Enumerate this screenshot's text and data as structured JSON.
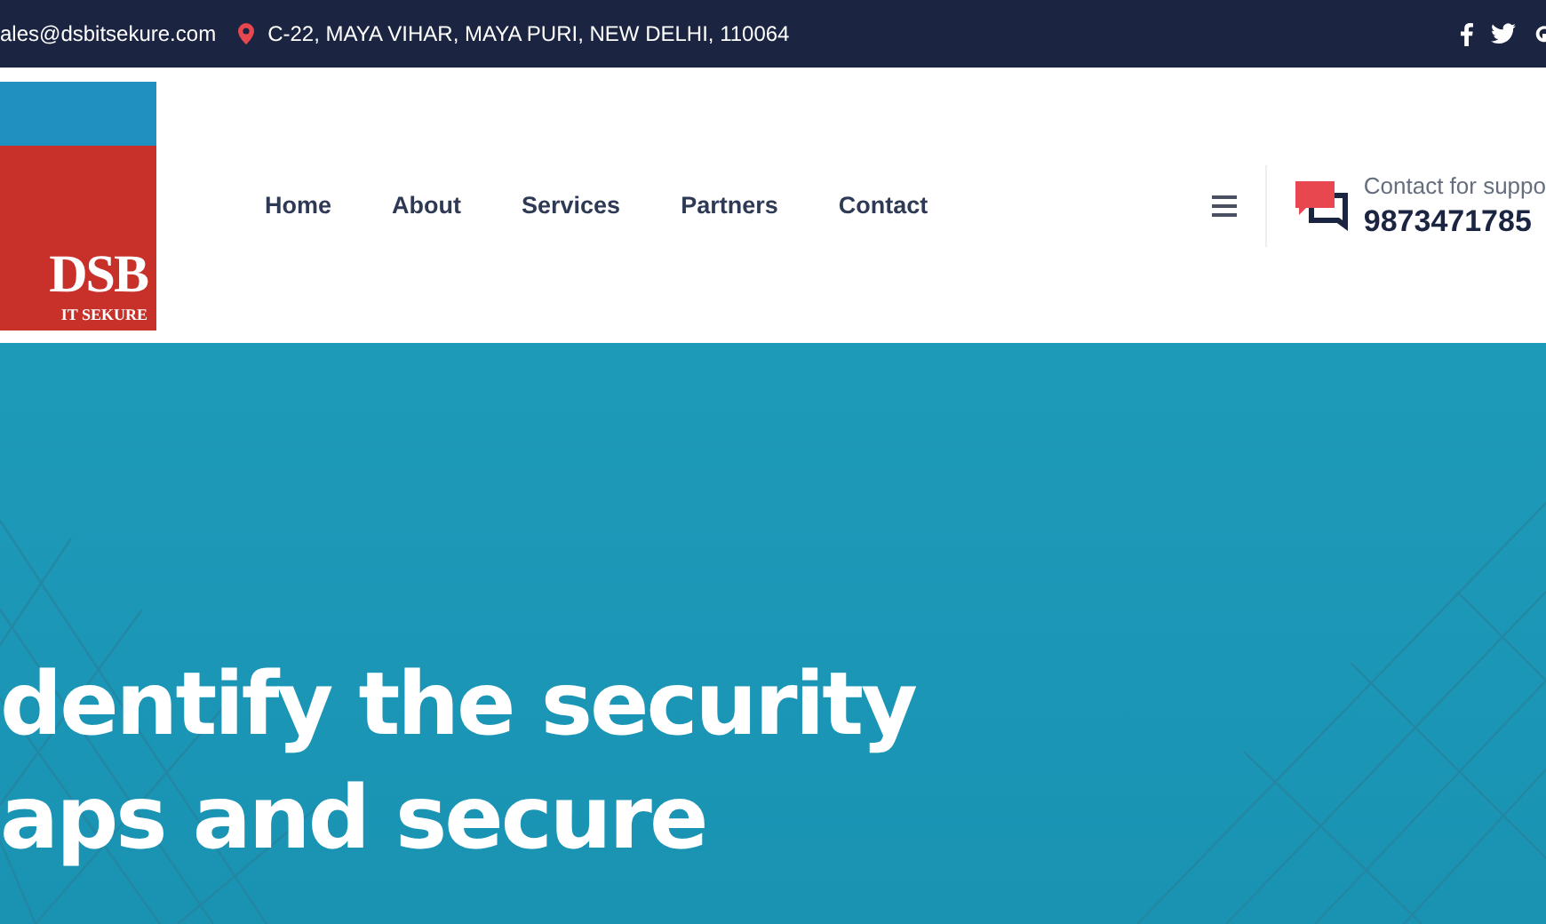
{
  "top_bar": {
    "email": "ales@dsbitsekure.com",
    "address": "C-22, MAYA VIHAR, MAYA PURI, NEW DELHI, 110064"
  },
  "logo": {
    "title": "DSB",
    "subtitle": "IT SEKURE"
  },
  "nav": {
    "items": [
      {
        "label": "Home"
      },
      {
        "label": "About"
      },
      {
        "label": "Services"
      },
      {
        "label": "Partners"
      },
      {
        "label": "Contact"
      }
    ]
  },
  "contact": {
    "label": "Contact for suppo",
    "phone": "9873471785"
  },
  "hero": {
    "lines": [
      "dentify the security",
      "aps and secure"
    ]
  }
}
